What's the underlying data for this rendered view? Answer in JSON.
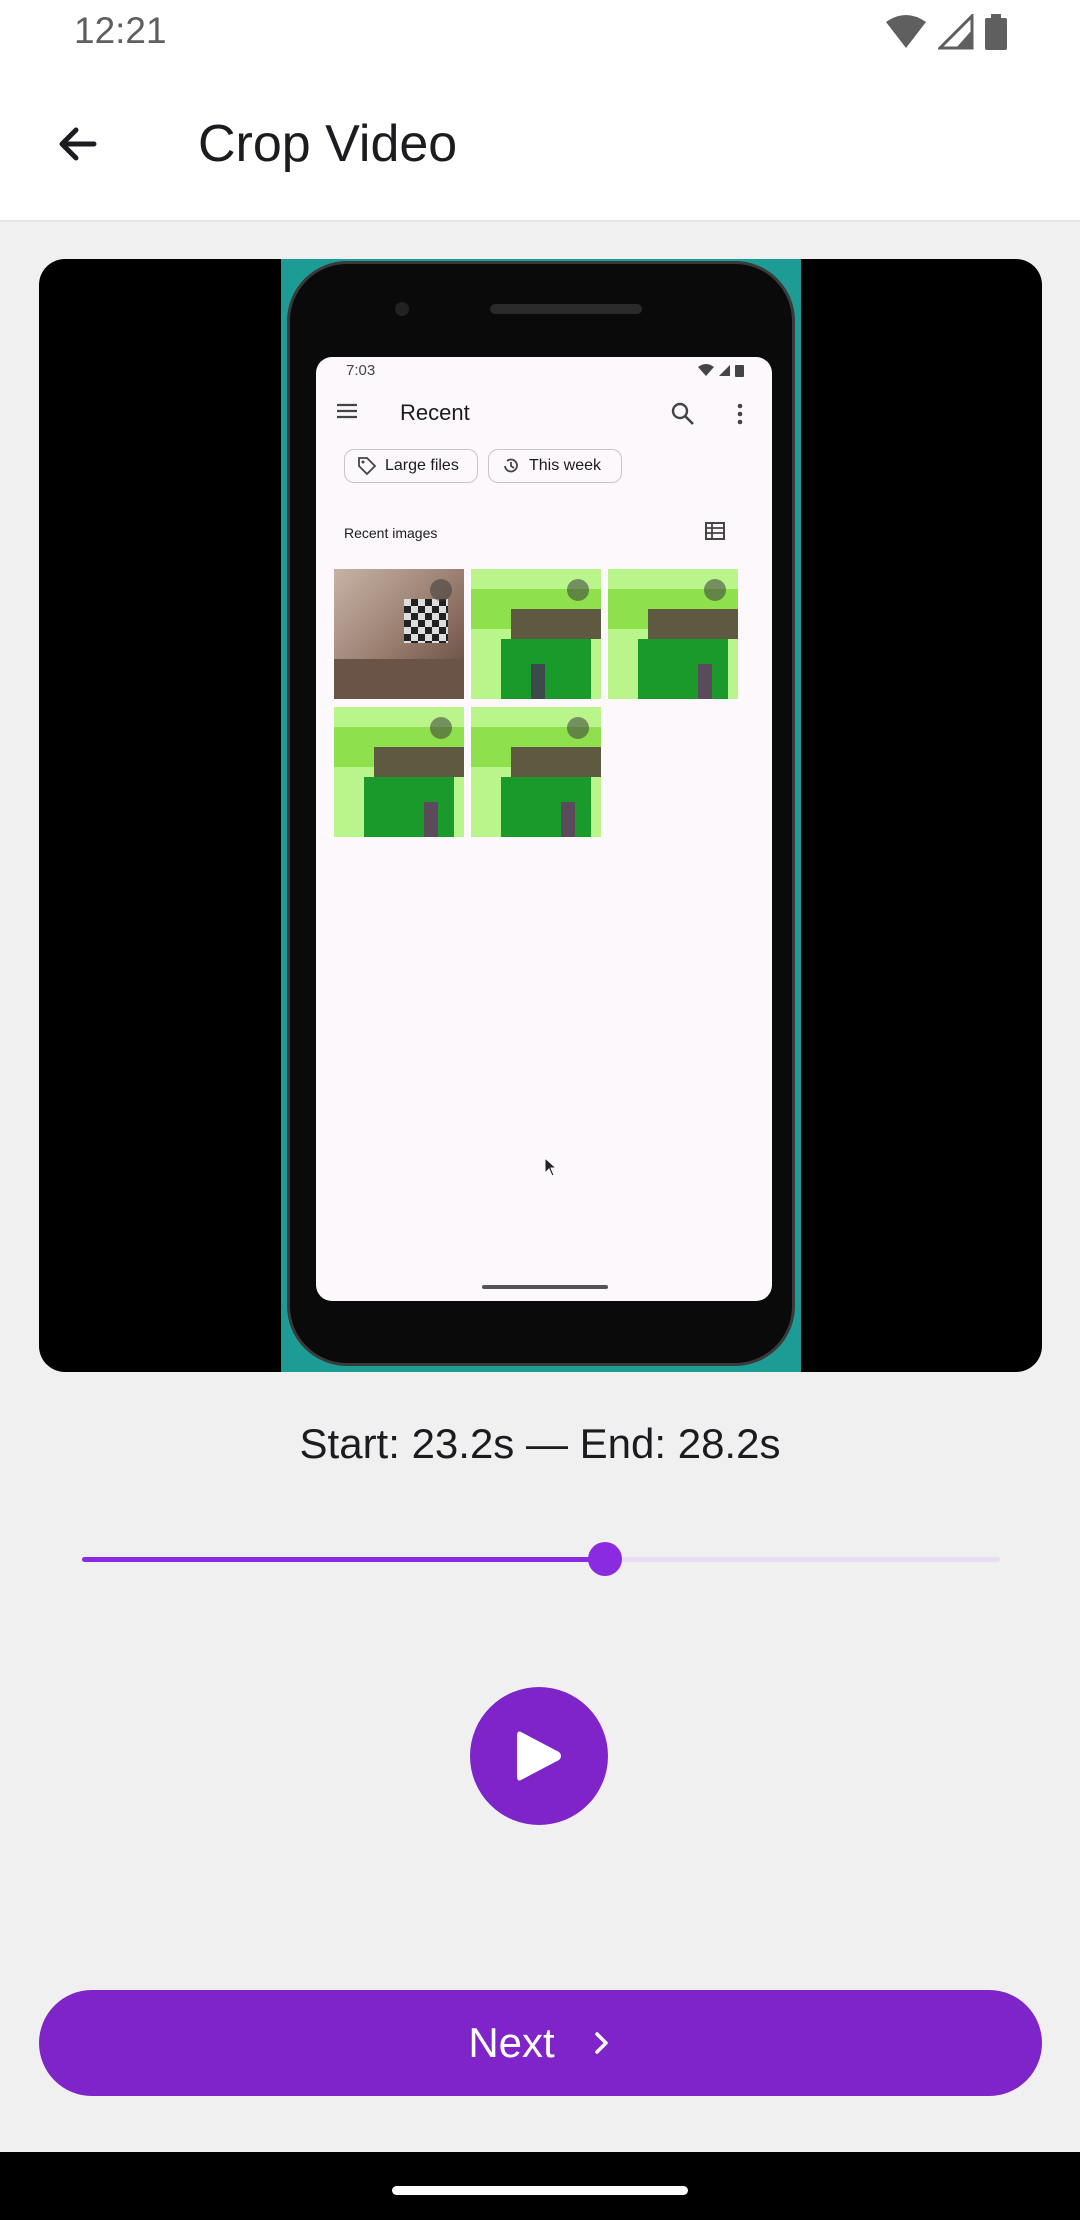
{
  "status_bar": {
    "time": "12:21"
  },
  "app_bar": {
    "title": "Crop Video"
  },
  "video_preview": {
    "inner_screen": {
      "time": "7:03",
      "title": "Recent",
      "chips": [
        "Large files",
        "This week"
      ],
      "section_title": "Recent images"
    }
  },
  "trim": {
    "range_label": "Start: 23.2s — End: 28.2s",
    "slider_fraction": 0.57
  },
  "actions": {
    "next_label": "Next"
  },
  "colors": {
    "accent": "#7f24c8",
    "track_inactive": "#e8ddf3",
    "video_bg": "#1c9c95"
  }
}
